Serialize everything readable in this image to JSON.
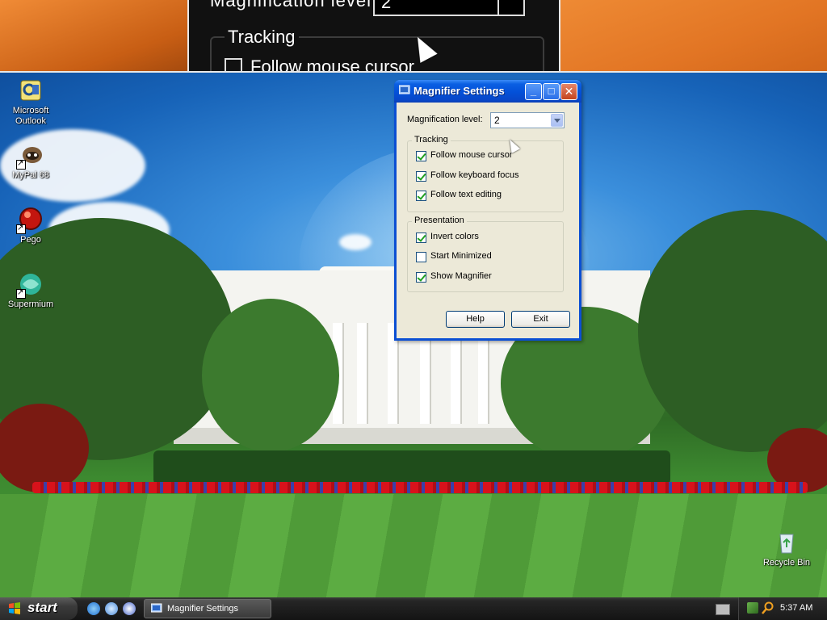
{
  "magnifier_strip": {
    "partial_text": "Magnification level:",
    "value": "2",
    "group_title": "Tracking",
    "check_label": "Follow mouse cursor"
  },
  "desktop_icons": [
    {
      "label": "Microsoft Outlook",
      "icon": "outlook-icon"
    },
    {
      "label": "MyPal 68",
      "icon": "mypal-icon"
    },
    {
      "label": "Pego",
      "icon": "pego-icon"
    },
    {
      "label": "Supermium",
      "icon": "supermium-icon"
    },
    {
      "label": "Recycle Bin",
      "icon": "recycle-bin-icon"
    }
  ],
  "window": {
    "title": "Magnifier Settings",
    "magnification_label": "Magnification level:",
    "magnification_value": "2",
    "tracking": {
      "title": "Tracking",
      "options": [
        {
          "label": "Follow mouse cursor",
          "checked": true
        },
        {
          "label": "Follow keyboard focus",
          "checked": true
        },
        {
          "label": "Follow text editing",
          "checked": true
        }
      ]
    },
    "presentation": {
      "title": "Presentation",
      "options": [
        {
          "label": "Invert colors",
          "checked": true
        },
        {
          "label": "Start Minimized",
          "checked": false
        },
        {
          "label": "Show Magnifier",
          "checked": true
        }
      ]
    },
    "help_label": "Help",
    "exit_label": "Exit"
  },
  "taskbar": {
    "start_label": "start",
    "task_label": "Magnifier Settings",
    "clock": "5:37 AM",
    "quick_launch": [
      "internet-explorer-icon",
      "browser-icon",
      "media-player-icon"
    ],
    "tray_icons": [
      "keyboard-icon",
      "network-icon",
      "magnifier-tray-icon"
    ]
  },
  "colors": {
    "title_bar": "#0350d8",
    "window_bg": "#ece9d8",
    "taskbar": "#1c1c1c"
  }
}
